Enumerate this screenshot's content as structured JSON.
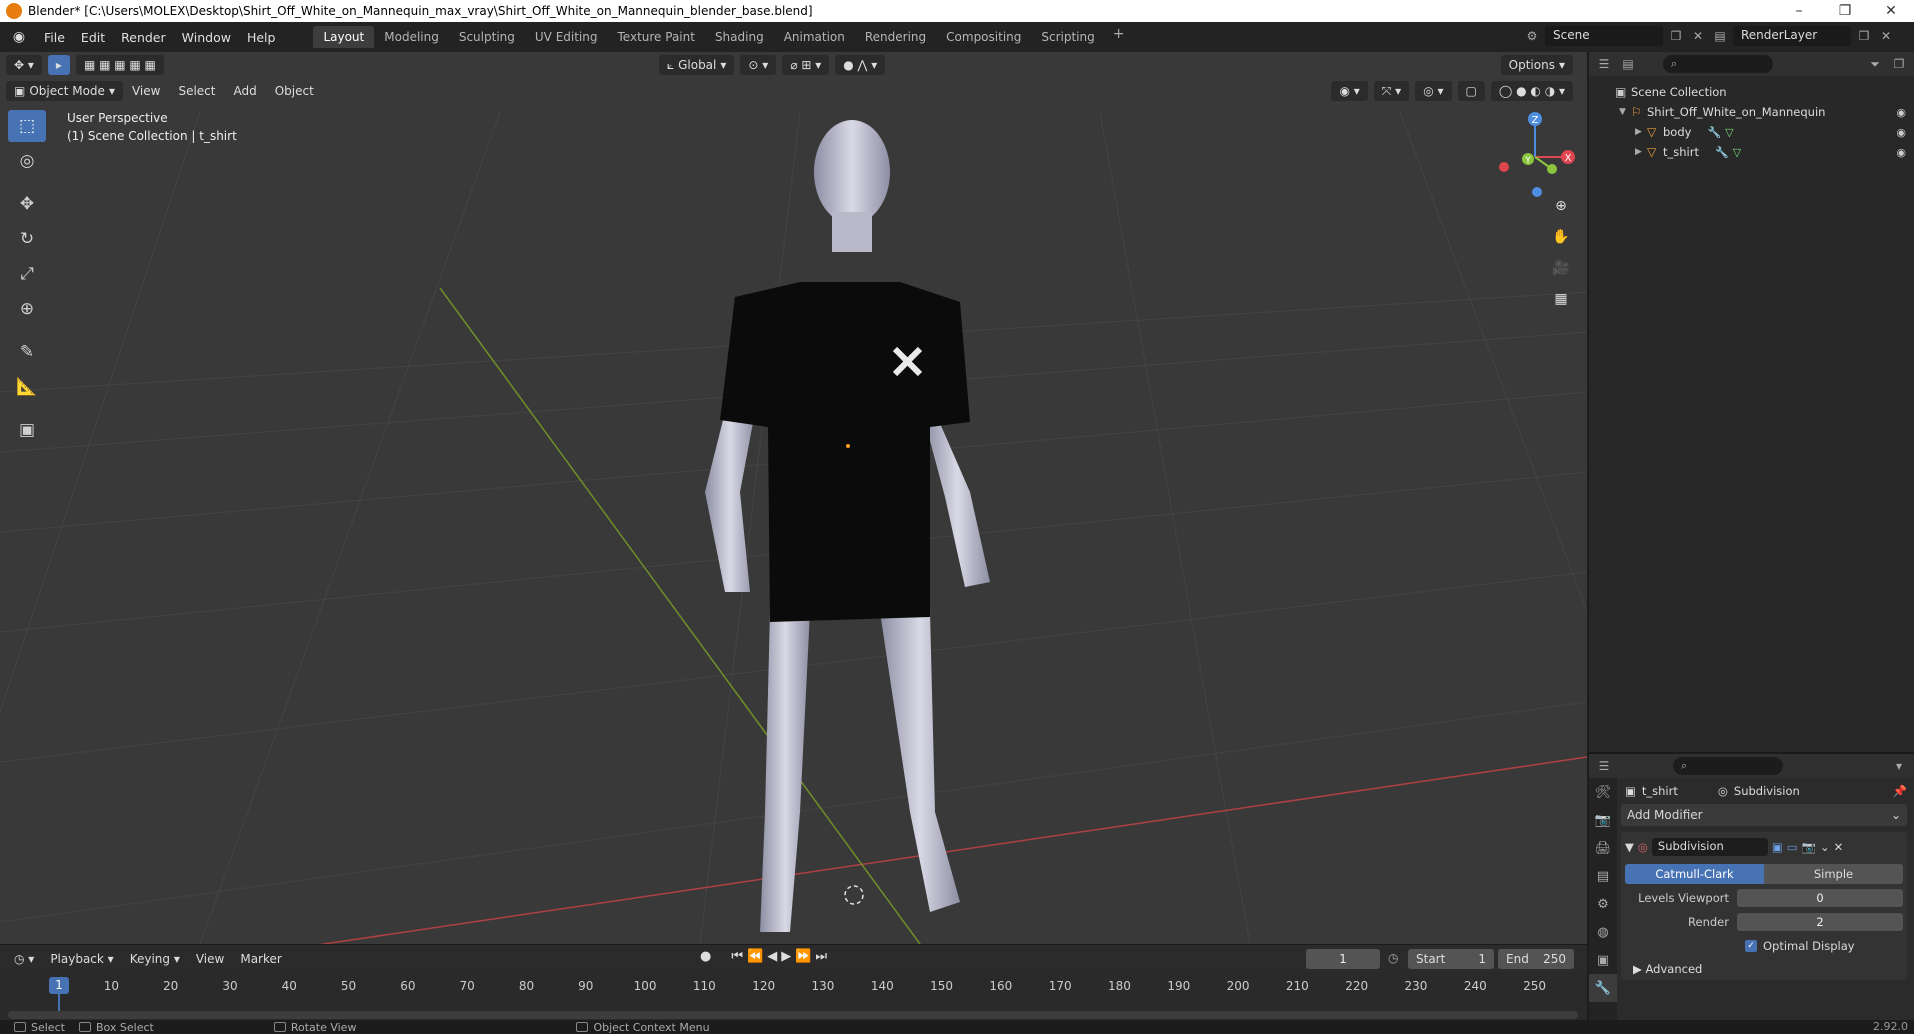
{
  "window": {
    "title": "Blender* [C:\\Users\\MOLEX\\Desktop\\Shirt_Off_White_on_Mannequin_max_vray\\Shirt_Off_White_on_Mannequin_blender_base.blend]",
    "min": "–",
    "max": "❐",
    "close": "✕"
  },
  "menu": [
    "File",
    "Edit",
    "Render",
    "Window",
    "Help"
  ],
  "workspaces": [
    "Layout",
    "Modeling",
    "Sculpting",
    "UV Editing",
    "Texture Paint",
    "Shading",
    "Animation",
    "Rendering",
    "Compositing",
    "Scripting"
  ],
  "scene": {
    "name": "Scene",
    "render_layer": "RenderLayer"
  },
  "viewport": {
    "mode": "Object Mode",
    "menus": [
      "View",
      "Select",
      "Add",
      "Object"
    ],
    "orientation": "Global",
    "options": "Options",
    "overlay_line1": "User Perspective",
    "overlay_line2": "(1) Scene Collection | t_shirt",
    "gizmo": {
      "z": "Z",
      "y": "Y",
      "x": "X"
    }
  },
  "timeline": {
    "menus": [
      "Playback",
      "Keying",
      "View",
      "Marker"
    ],
    "current_frame": "1",
    "start_label": "Start",
    "start_value": "1",
    "end_label": "End",
    "end_value": "250",
    "ticks": [
      "1",
      "10",
      "20",
      "30",
      "40",
      "50",
      "60",
      "70",
      "80",
      "90",
      "100",
      "110",
      "120",
      "130",
      "140",
      "150",
      "160",
      "170",
      "180",
      "190",
      "200",
      "210",
      "220",
      "230",
      "240",
      "250"
    ]
  },
  "outliner": {
    "root": "Scene Collection",
    "collection": "Shirt_Off_White_on_Mannequin",
    "objects": [
      "body",
      "t_shirt"
    ]
  },
  "properties": {
    "object": "t_shirt",
    "modifier_crumb": "Subdivision",
    "add_modifier": "Add Modifier",
    "modifier_name": "Subdivision",
    "type_a": "Catmull-Clark",
    "type_b": "Simple",
    "levels_viewport_label": "Levels Viewport",
    "levels_viewport_value": "0",
    "render_label": "Render",
    "render_value": "2",
    "optimal_display": "Optimal Display",
    "advanced": "Advanced"
  },
  "status": {
    "select": "Select",
    "box_select": "Box Select",
    "rotate_view": "Rotate View",
    "context_menu": "Object Context Menu",
    "version": "2.92.0"
  },
  "colors": {
    "accent": "#4772b3",
    "viewport_bg": "#393939",
    "x_axis": "#e0464f",
    "y_axis": "#8cc63f",
    "z_axis": "#4e8ee0"
  }
}
